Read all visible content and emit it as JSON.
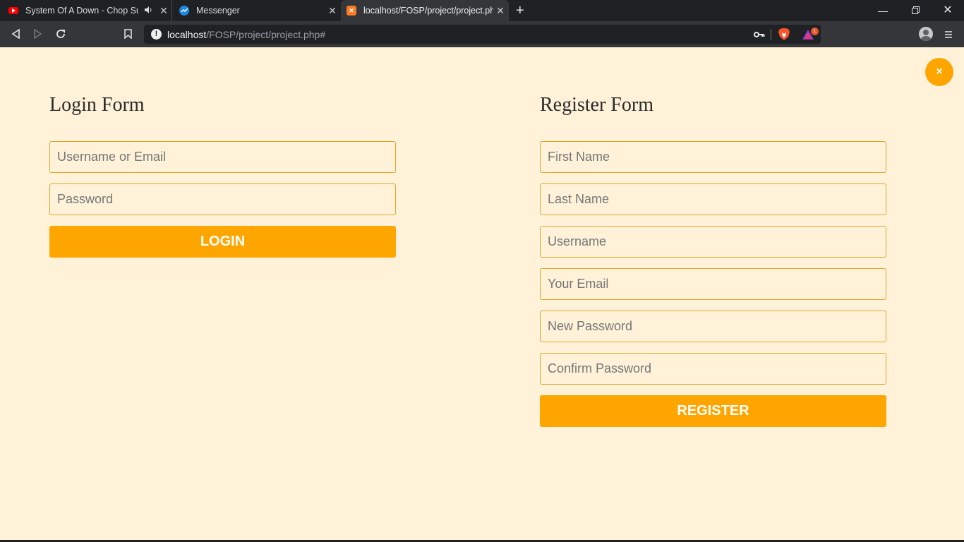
{
  "browser": {
    "tabs": [
      {
        "title": "System Of A Down - Chop Suey",
        "favicon": "youtube-icon",
        "audio": "speaker-icon"
      },
      {
        "title": "Messenger",
        "favicon": "messenger-icon"
      },
      {
        "title": "localhost/FOSP/project/project.php#",
        "favicon": "xampp-icon",
        "active": true
      }
    ],
    "new_tab": "+",
    "url": {
      "host": "localhost",
      "path": "/FOSP/project/project.php#"
    },
    "info_icon": "!",
    "extension_badge": "1"
  },
  "page": {
    "close_label": "×",
    "login": {
      "title": "Login Form",
      "username_placeholder": "Username or Email",
      "password_placeholder": "Password",
      "submit_label": "LOGIN"
    },
    "register": {
      "title": "Register Form",
      "first_name_placeholder": "First Name",
      "last_name_placeholder": "Last Name",
      "username_placeholder": "Username",
      "email_placeholder": "Your Email",
      "new_password_placeholder": "New Password",
      "confirm_password_placeholder": "Confirm Password",
      "submit_label": "REGISTER"
    }
  },
  "colors": {
    "accent": "#ffa500",
    "background": "#fff2d9",
    "field_border": "#e0a526"
  }
}
